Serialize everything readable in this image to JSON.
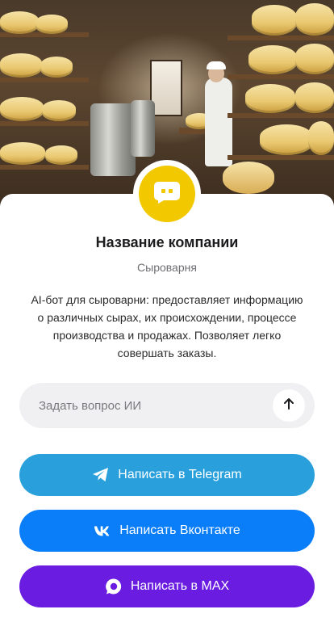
{
  "company": {
    "name": "Название компании",
    "category": "Сыроварня",
    "description": "AI-бот для сыроварни: предоставляет информацию о различных сырах, их происхождении, процессе производства и продажах. Позволяет легко совершать заказы."
  },
  "ask": {
    "placeholder": "Задать вопрос ИИ",
    "value": ""
  },
  "buttons": {
    "telegram": "Написать в Telegram",
    "vk": "Написать Вконтакте",
    "max": "Написать в MAX"
  },
  "icons": {
    "avatar": "chat-bot-icon",
    "send": "arrow-up-icon",
    "telegram": "telegram-icon",
    "vk": "vk-icon",
    "max": "max-icon"
  },
  "colors": {
    "avatar": "#f2c900",
    "telegram": "#29a0dc",
    "vk": "#0a7df8",
    "max": "#6a1de0"
  }
}
